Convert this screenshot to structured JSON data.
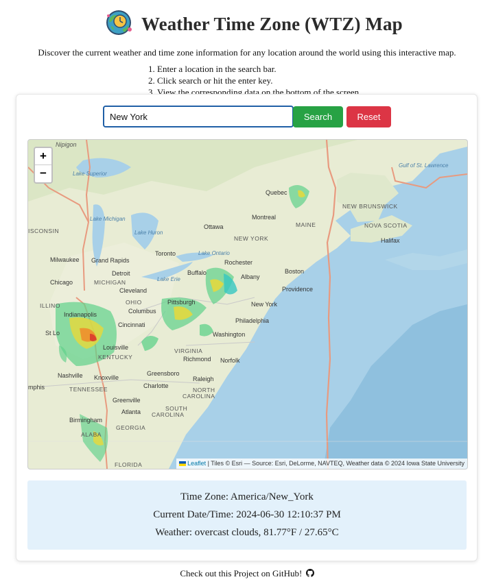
{
  "header": {
    "title": "Weather Time Zone (WTZ) Map",
    "logo_icon": "globe-clock-icon"
  },
  "intro": "Discover the current weather and time zone information for any location around the world using this interactive map.",
  "steps": [
    "Enter a location in the search bar.",
    "Click search or hit the enter key.",
    "View the corresponding data on the bottom of the screen."
  ],
  "search": {
    "value": "New York",
    "placeholder": "",
    "search_label": "Search",
    "reset_label": "Reset",
    "search_color": "#27a244",
    "reset_color": "#dc3545"
  },
  "map": {
    "zoom_in": "+",
    "zoom_out": "−",
    "attribution_link": "Leaflet",
    "attribution_text": " | Tiles © Esri — Source: Esri, DeLorme, NAVTEQ, Weather data © 2024 Iowa State University",
    "places": {
      "nipigon": "Nipigon",
      "lake_superior": "Lake Superior",
      "lake_michigan": "Lake Michigan",
      "lake_huron": "Lake Huron",
      "lake_ontario": "Lake Ontario",
      "lake_erie": "Lake Erie",
      "gulf_st_lawrence": "Gulf of St. Lawrence",
      "quebec": "Quebec",
      "montreal": "Montreal",
      "ottawa": "Ottawa",
      "new_brunswick": "NEW BRUNSWICK",
      "maine": "MAINE",
      "nova_scotia": "NOVA SCOTIA",
      "halifax": "Halifax",
      "wisconsin": "ISCONSIN",
      "new_york_state": "NEW YORK",
      "milwaukee": "Milwaukee",
      "grand_rapids": "Grand Rapids",
      "toronto": "Toronto",
      "rochester": "Rochester",
      "michigan": "MICHIGAN",
      "detroit": "Detroit",
      "buffalo": "Buffalo",
      "albany": "Albany",
      "boston": "Boston",
      "providence": "Providence",
      "chicago": "Chicago",
      "cleveland": "Cleveland",
      "ohio": "OHIO",
      "pittsburgh": "Pittsburgh",
      "new_york": "New York",
      "illinois": "ILLINO",
      "indianapolis": "Indianapolis",
      "columbus": "Columbus",
      "cincinnati": "Cincinnati",
      "philadelphia": "Philadelphia",
      "st_louis": "St Lo",
      "washington": "Washington",
      "louisville": "Louisville",
      "kentucky": "KENTUCKY",
      "virginia": "VIRGINIA",
      "richmond": "Richmond",
      "norfolk": "Norfolk",
      "nashville": "Nashville",
      "knoxville": "Knoxville",
      "greensboro": "Greensboro",
      "raleigh": "Raleigh",
      "memphis": "mphis",
      "tennessee": "TENNESSEE",
      "charlotte": "Charlotte",
      "north_carolina_1": "NORTH",
      "north_carolina_2": "CAROLINA",
      "greenville": "Greenville",
      "atlanta": "Atlanta",
      "south_carolina_1": "SOUTH",
      "south_carolina_2": "CAROLINA",
      "birmingham": "Birmingham",
      "georgia": "GEORGIA",
      "alabama": "ALABA",
      "florida": "FLORIDA"
    }
  },
  "info": {
    "timezone": "Time Zone: America/New_York",
    "datetime": "Current Date/Time: 2024-06-30 12:10:37 PM",
    "weather": "Weather: overcast clouds, 81.77°F / 27.65°C"
  },
  "footer": {
    "text": "Check out this Project on GitHub! ",
    "icon": "github-icon"
  }
}
